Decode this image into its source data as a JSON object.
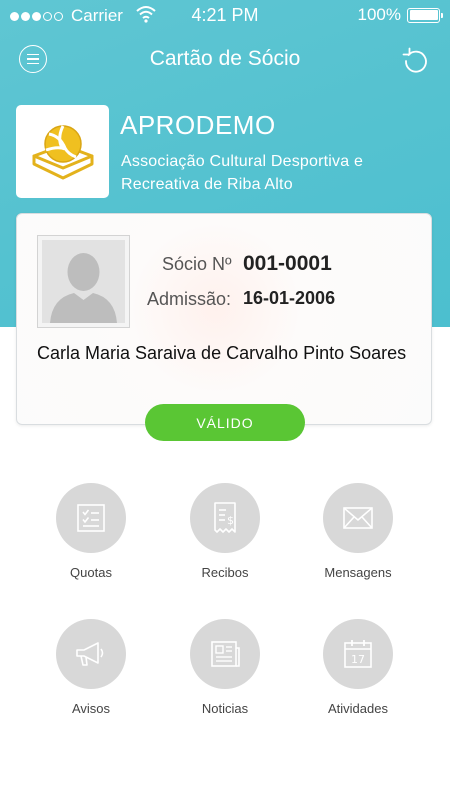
{
  "status_bar": {
    "carrier": "Carrier",
    "time": "4:21 PM",
    "battery": "100%"
  },
  "nav": {
    "title": "Cartão de Sócio",
    "menu_icon": "hamburger-icon",
    "refresh_icon": "refresh-icon"
  },
  "club": {
    "name": "APRODEMO",
    "description": "Associação Cultural Desportiva e Recreativa de Riba Alto",
    "logo_icon": "volleyball-icon"
  },
  "member": {
    "number_label": "Sócio Nº",
    "number": "001-0001",
    "admission_label": "Admissão:",
    "admission_date": "16-01-2006",
    "name": "Carla Maria Saraiva de Carvalho Pinto Soares",
    "status": "VÁLIDO"
  },
  "menu": [
    {
      "label": "Quotas",
      "icon": "checklist-icon"
    },
    {
      "label": "Recibos",
      "icon": "receipt-icon"
    },
    {
      "label": "Mensagens",
      "icon": "envelope-icon"
    },
    {
      "label": "Avisos",
      "icon": "megaphone-icon"
    },
    {
      "label": "Noticias",
      "icon": "newspaper-icon"
    },
    {
      "label": "Atividades",
      "icon": "calendar-icon"
    }
  ],
  "calendar_day": "17",
  "colors": {
    "header": "#55c2d0",
    "valid": "#5ac634",
    "circle": "#d8d8d8"
  }
}
